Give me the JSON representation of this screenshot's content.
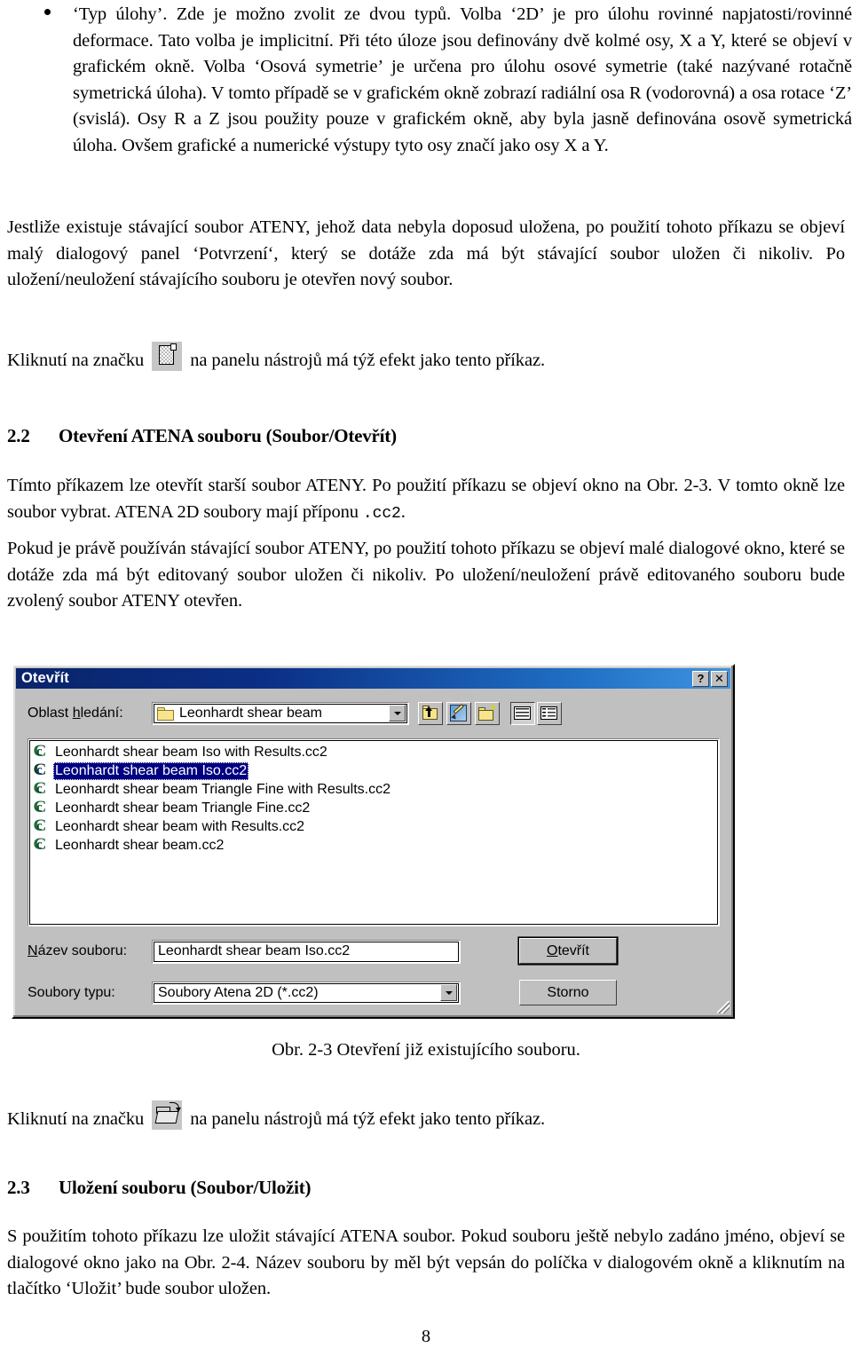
{
  "document": {
    "bullet_paragraph": "‘Typ úlohy’. Zde je možno zvolit ze dvou typů. Volba ‘2D’ je pro úlohu rovinné napjatosti/rovinné deformace. Tato volba je implicitní. Při této úloze jsou definovány dvě kolmé osy, X a Y, které se objeví v grafickém okně. Volba ‘Osová symetrie’ je určena pro úlohu osové symetrie (také nazývané rotačně symetrická úloha). V tomto případě se v grafickém okně zobrazí radiální osa R (vodorovná) a osa rotace ‘Z’ (svislá). Osy R a Z jsou použity pouze v grafickém okně, aby byla jasně definována osově symetrická úloha. Ovšem grafické a numerické výstupy tyto osy značí jako osy X a Y.",
    "paragraph_jestlize": "Jestliže existuje stávající soubor ATENY, jehož data nebyla doposud uložena, po použití tohoto příkazu se objeví malý dialogový panel ‘Potvrzení‘, který se dotáže zda má být stávající soubor uložen či nikoliv. Po uložení/neuložení stávajícího souboru je otevřen nový soubor.",
    "click_line_1_before": "Kliknutí na značku",
    "click_line_1_after": "na panelu nástrojů má týž efekt jako tento příkaz.",
    "click_line_2_before": "Kliknutí na značku",
    "click_line_2_after": "na panelu nástrojů má týž efekt jako tento příkaz.",
    "heading_22_number": "2.2",
    "heading_22_title": "Otevření ATENA souboru (Soubor/Otevřít)",
    "paragraph_timto_part1": "Tímto příkazem lze otevřít starší soubor ATENY. Po použití příkazu se objeví okno na Obr. 2-3. V tomto okně lze soubor vybrat. ATENA 2D soubory mají příponu ",
    "paragraph_timto_mono": ".cc2",
    "paragraph_timto_part2": ".",
    "paragraph_pokud": "Pokud je právě používán stávající soubor ATENY, po použití tohoto příkazu se objeví malé dialogové okno, které se dotáže zda má být editovaný soubor uložen či nikoliv. Po uložení/neuložení právě editovaného souboru bude zvolený soubor ATENY otevřen.",
    "figure_caption": "Obr. 2-3  Otevření již existujícího souboru.",
    "heading_23_number": "2.3",
    "heading_23_title": "Uložení souboru (Soubor/Uložit)",
    "paragraph_spouzitim": "S použitím tohoto příkazu lze uložit stávající ATENA soubor. Pokud souboru ještě nebylo zadáno jméno, objeví se dialogové okno jako na Obr. 2-4. Název souboru by měl být vepsán do políčka v dialogovém okně a kliknutím na tlačítko ‘Uložit’ bude soubor uložen.",
    "page_number": "8"
  },
  "dialog": {
    "title": "Otevřít",
    "help_button": "?",
    "close_button": "✕",
    "lookin_label_pre": "Oblast ",
    "lookin_label_underlined": "h",
    "lookin_label_post": "ledání:",
    "lookin_value": "Leonhardt shear beam",
    "toolbar": {
      "up_one_level": "up-one-level",
      "favorites": "favorites",
      "new_folder": "new-folder",
      "list_view": "list-view",
      "details_view": "details-view"
    },
    "files": [
      {
        "name": "Leonhardt shear beam Iso with Results.cc2",
        "selected": false
      },
      {
        "name": "Leonhardt shear beam Iso.cc2",
        "selected": true
      },
      {
        "name": "Leonhardt shear beam Triangle Fine with Results.cc2",
        "selected": false
      },
      {
        "name": "Leonhardt shear beam Triangle Fine.cc2",
        "selected": false
      },
      {
        "name": "Leonhardt shear beam with Results.cc2",
        "selected": false
      },
      {
        "name": "Leonhardt shear beam.cc2",
        "selected": false
      }
    ],
    "filename_label_underlined": "N",
    "filename_label_post": "ázev souboru:",
    "filename_value": "Leonhardt shear beam Iso.cc2",
    "filetype_label": "Soubory typu:",
    "filetype_value": "Soubory Atena 2D (*.cc2)",
    "open_button_underlined": "O",
    "open_button_post": "tevřít",
    "cancel_button": "Storno"
  },
  "colors": {
    "title_gradient_start": "#0a246a",
    "title_gradient_end": "#3f93e0",
    "dialog_face": "#c0c0c0",
    "selection": "#000080",
    "file_icon": "#1d6b3a"
  }
}
